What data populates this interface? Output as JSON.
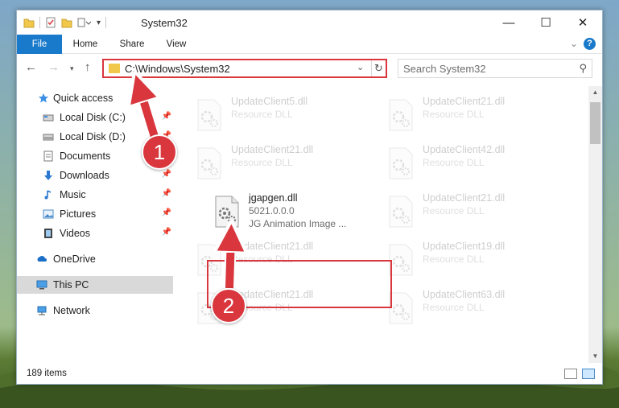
{
  "window": {
    "title": "System32",
    "controls": {
      "minimize": "—",
      "maximize": "☐",
      "close": "✕"
    }
  },
  "ribbon": {
    "tabs": [
      "File",
      "Home",
      "Share",
      "View"
    ]
  },
  "navigation": {
    "address": "C:\\Windows\\System32",
    "search_placeholder": "Search System32"
  },
  "sidebar": {
    "items": [
      {
        "label": "Quick access",
        "icon": "star-icon"
      },
      {
        "label": "Local Disk (C:)",
        "icon": "drive-icon",
        "pinned": true
      },
      {
        "label": "Local Disk (D:)",
        "icon": "drive-icon",
        "pinned": true
      },
      {
        "label": "Documents",
        "icon": "documents-icon",
        "pinned": true
      },
      {
        "label": "Downloads",
        "icon": "downloads-icon",
        "pinned": true
      },
      {
        "label": "Music",
        "icon": "music-icon",
        "pinned": true
      },
      {
        "label": "Pictures",
        "icon": "pictures-icon",
        "pinned": true
      },
      {
        "label": "Videos",
        "icon": "videos-icon",
        "pinned": true
      },
      {
        "label": "OneDrive",
        "icon": "cloud-icon"
      },
      {
        "label": "This PC",
        "icon": "computer-icon",
        "selected": true
      },
      {
        "label": "Network",
        "icon": "network-icon"
      }
    ]
  },
  "files": {
    "left_column": [
      {
        "name": "UpdateClient5.dll",
        "type": "Resource DLL"
      },
      {
        "name": "UpdateClient21.dll",
        "type": "Resource DLL"
      },
      {
        "name": "jgapgen.dll",
        "type": "5021.0.0.0",
        "description": "JG Animation Image ..."
      },
      {
        "name": "UpdateClient21.dll",
        "type": "Resource DLL"
      },
      {
        "name": "UpdateClient21.dll",
        "type": "Resource DLL"
      }
    ],
    "right_column": [
      {
        "name": "UpdateClient21.dll",
        "type": "Resource DLL"
      },
      {
        "name": "UpdateClient42.dll",
        "type": "Resource DLL"
      },
      {
        "name": "UpdateClient21.dll",
        "type": "Resource DLL"
      },
      {
        "name": "UpdateClient19.dll",
        "type": "Resource DLL"
      },
      {
        "name": "UpdateClient63.dll",
        "type": "Resource DLL"
      }
    ]
  },
  "status": {
    "item_count": "189 items"
  },
  "annotations": {
    "step1": "1",
    "step2": "2",
    "color": "#d9363e"
  }
}
